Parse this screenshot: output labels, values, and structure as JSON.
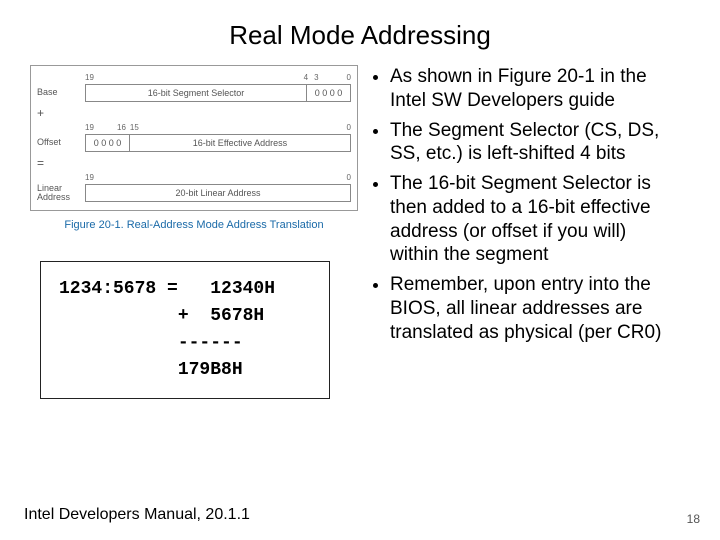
{
  "title": "Real Mode Addressing",
  "figure": {
    "row1": {
      "label": "Base",
      "main": "16-bit Segment Selector",
      "right": "0 0 0 0",
      "bits": {
        "hi": "19",
        "mid_hi": "4",
        "mid_lo": "3",
        "lo": "0"
      }
    },
    "plus": "+",
    "row2": {
      "label": "Offset",
      "left": "0 0 0 0",
      "main": "16-bit Effective Address",
      "bits": {
        "hi": "19",
        "mid_hi": "16",
        "mid_lo": "15",
        "lo": "0"
      }
    },
    "eq": "=",
    "row3": {
      "label": "Linear\nAddress",
      "main": "20-bit Linear Address",
      "bits": {
        "hi": "19",
        "lo": "0"
      }
    },
    "caption": "Figure 20-1. Real-Address Mode Address Translation"
  },
  "calc": {
    "line1": "1234:5678 =   12340H",
    "line2": "           +  5678H",
    "line3": "           ------",
    "line4": "           179B8H"
  },
  "bullets": [
    "As shown in Figure 20-1 in the Intel SW Developers guide",
    "The Segment Selector (CS, DS, SS, etc.) is left-shifted 4 bits",
    "The 16-bit Segment Selector is then added to a 16-bit effective address (or offset if you will) within the segment",
    "Remember, upon entry into the BIOS, all linear addresses are translated as physical (per CR0)"
  ],
  "footer": "Intel  Developers Manual, 20.1.1",
  "page": "18"
}
